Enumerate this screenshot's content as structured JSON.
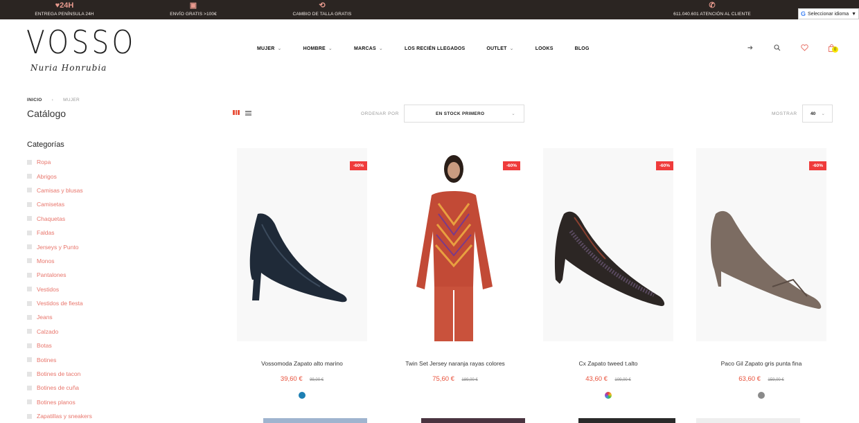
{
  "topbar": {
    "items": [
      {
        "icon": "♥24H",
        "text": "ENTREGA PENÍNSULA 24H"
      },
      {
        "icon": "▣",
        "text": "ENVÍO GRATIS >100€"
      },
      {
        "icon": "⟲",
        "text": "CAMBIO DE TALLA GRATIS"
      },
      {
        "icon": "✆",
        "text": "611.040.601 ATENCIÓN AL CLIENTE"
      }
    ],
    "language_label": "Seleccionar idioma"
  },
  "header": {
    "logo_text": "VOSSO",
    "logo_sub": "Nuria Honrubia",
    "nav": [
      {
        "label": "MUJER",
        "has_menu": true
      },
      {
        "label": "HOMBRE",
        "has_menu": true
      },
      {
        "label": "MARCAS",
        "has_menu": true
      },
      {
        "label": "LOS RECIÉN LLEGADOS",
        "has_menu": false
      },
      {
        "label": "OUTLET",
        "has_menu": true
      },
      {
        "label": "LOOKS",
        "has_menu": false
      },
      {
        "label": "BLOG",
        "has_menu": false
      }
    ],
    "cart_count": "0"
  },
  "breadcrumb": {
    "home": "INICIO",
    "current": "MUJER"
  },
  "page_title": "Catálogo",
  "toolbar": {
    "order_label": "ORDENAR POR",
    "order_value": "EN STOCK PRIMERO",
    "show_label": "MOSTRAR",
    "show_value": "40"
  },
  "sidebar": {
    "title": "Categorías",
    "items": [
      "Ropa",
      "Abrigos",
      "Camisas y blusas",
      "Camisetas",
      "Chaquetas",
      "Faldas",
      "Jerseys y Punto",
      "Monos",
      "Pantalones",
      "Vestidos",
      "Vestidos de fiesta",
      "Jeans",
      "Calzado",
      "Botas",
      "Botines",
      "Botines de tacon",
      "Botines de cuña",
      "Botines planos",
      "Zapatillas y sneakers"
    ]
  },
  "products": [
    {
      "name": "Vossomoda Zapato alto marino",
      "price": "39,60 €",
      "old_price": "99,00 €",
      "discount": "-60%",
      "swatch": "#1d7fb3"
    },
    {
      "name": "Twin Set Jersey naranja rayas colores",
      "price": "75,60 €",
      "old_price": "189,00 €",
      "discount": "-60%",
      "swatch": ""
    },
    {
      "name": "Cx Zapato tweed t.alto",
      "price": "43,60 €",
      "old_price": "109,00 €",
      "discount": "-60%",
      "swatch": "multicolor"
    },
    {
      "name": "Paco Gil Zapato gris punta fina",
      "price": "63,60 €",
      "old_price": "159,00 €",
      "discount": "-60%",
      "swatch": "#8a8a8a"
    }
  ],
  "colors": {
    "accent": "#e8756b",
    "sale": "#ef3b3b",
    "topbar_bg": "#2b2522"
  }
}
